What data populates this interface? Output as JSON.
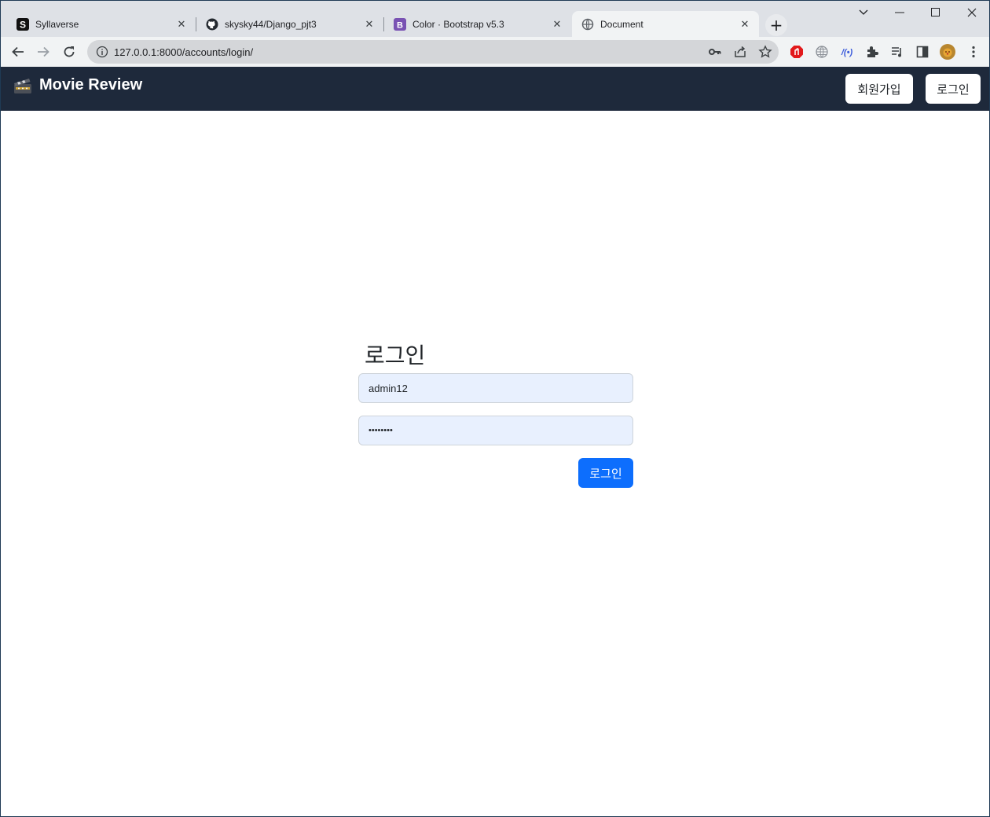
{
  "browser": {
    "tabs": [
      {
        "title": "Syllaverse",
        "icon": "syllaverse-s-icon"
      },
      {
        "title": "skysky44/Django_pjt3",
        "icon": "github-icon"
      },
      {
        "title": "Color · Bootstrap v5.3",
        "icon": "bootstrap-icon"
      },
      {
        "title": "Document",
        "icon": "globe-icon"
      }
    ],
    "close_glyph": "✕",
    "new_tab_glyph": "+",
    "url": "127.0.0.1:8000/accounts/login/"
  },
  "navbar": {
    "brand": "Movie Review",
    "signup_label": "회원가입",
    "login_label": "로그인",
    "bg_color": "#1e293b"
  },
  "login": {
    "heading": "로그인",
    "username_value": "admin12",
    "password_mask": "••••••••",
    "submit_label": "로그인",
    "accent_color": "#0d6efd"
  }
}
